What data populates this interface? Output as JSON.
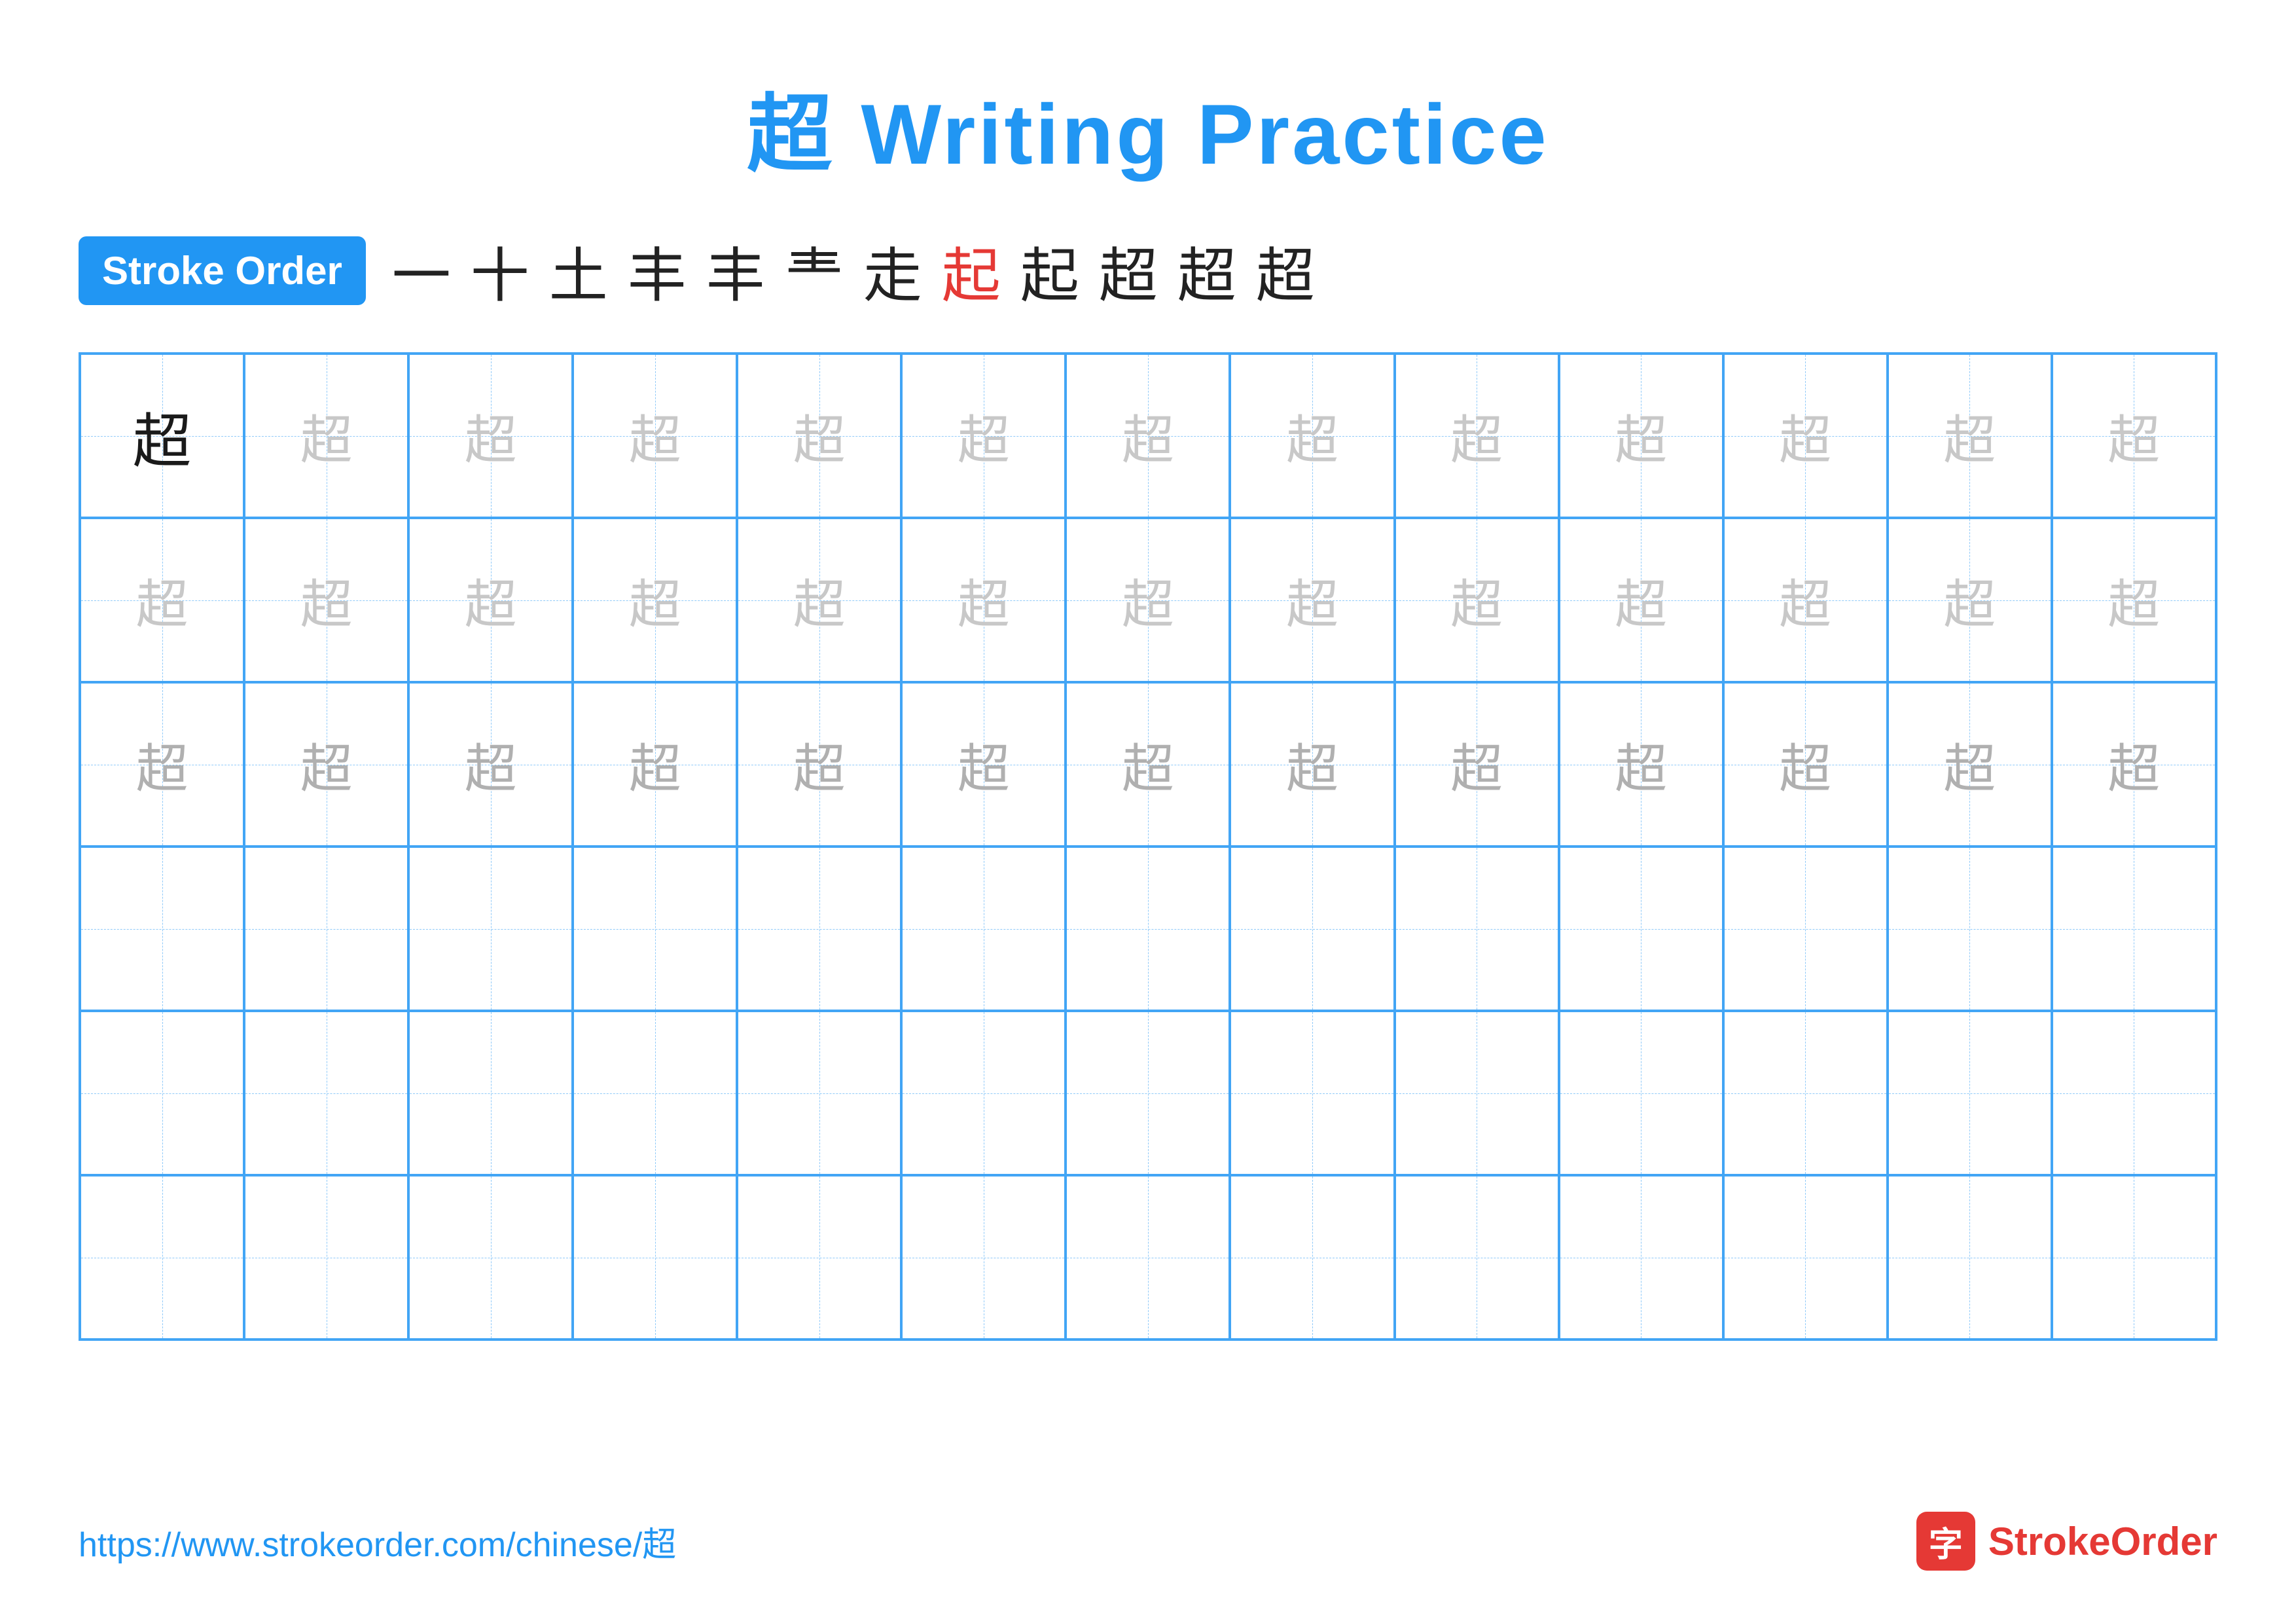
{
  "title": "超 Writing Practice",
  "stroke_order_badge": "Stroke Order",
  "stroke_sequence": [
    "一",
    "十",
    "土",
    "丰",
    "丰",
    "龶",
    "走",
    "起",
    "起",
    "超",
    "超",
    "超"
  ],
  "stroke_red_index": 7,
  "character": "超",
  "rows": [
    {
      "type": "dark_then_light1",
      "dark_count": 1,
      "char_count": 13
    },
    {
      "type": "light1",
      "char_count": 13
    },
    {
      "type": "light2",
      "char_count": 13
    },
    {
      "type": "empty",
      "char_count": 13
    },
    {
      "type": "empty",
      "char_count": 13
    },
    {
      "type": "empty",
      "char_count": 13
    }
  ],
  "footer_url": "https://www.strokeorder.com/chinese/超",
  "footer_logo_char": "字",
  "footer_logo_text": "StrokeOrder"
}
